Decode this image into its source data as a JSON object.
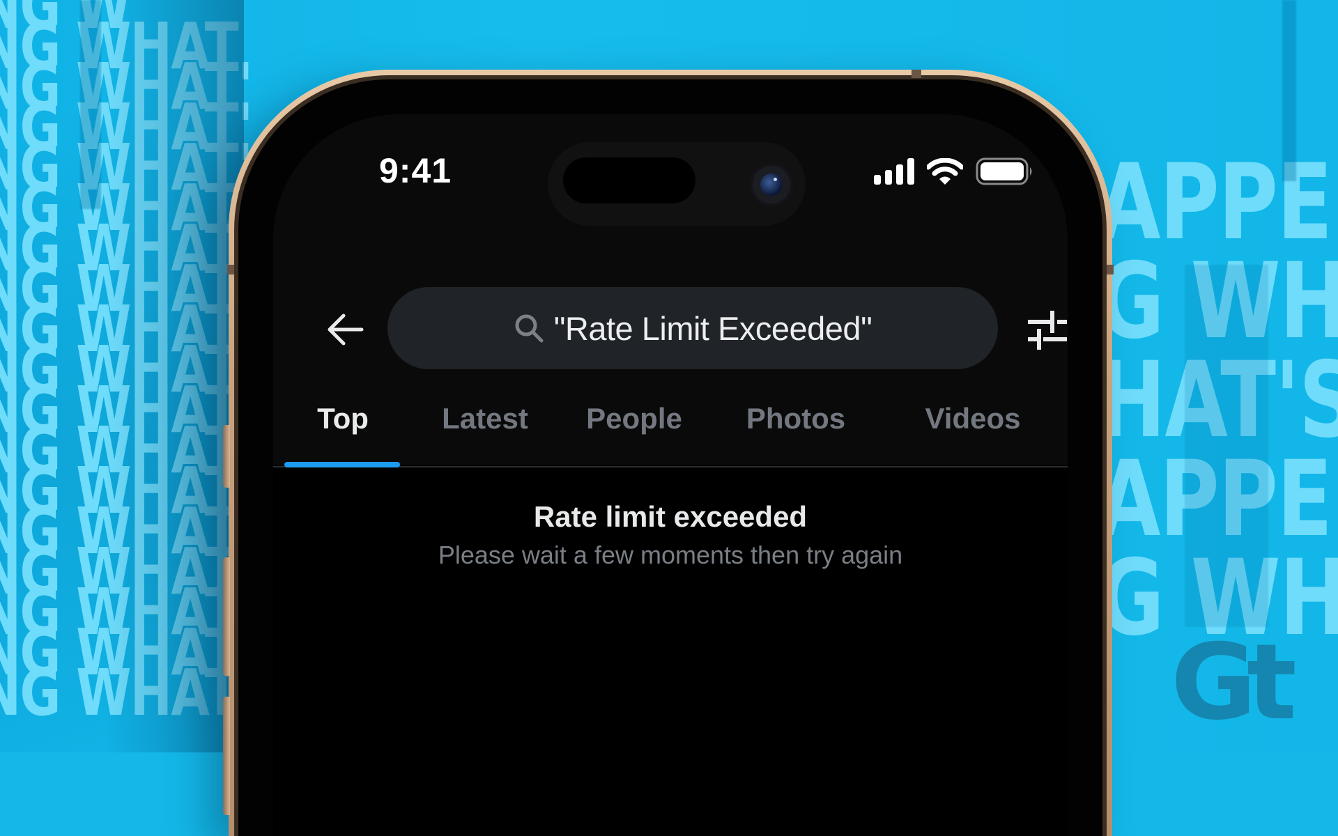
{
  "background": {
    "left_text_rows": [
      "NG W",
      "NG WHAT",
      "NG WHAT'",
      "NG WHAT'",
      "NG WHAT'",
      "NG WHAT'",
      "NG WHAT'",
      "NG WHAT'",
      "NG WHAT'",
      "NG WHAT'",
      "NG WHAT'",
      "NG WHAT'",
      "NG WHAT'",
      "NG WHAT'",
      "NG WHAT'",
      "NG WHAT'",
      "NG WHAT'",
      "NG WHAT'"
    ],
    "right_text_rows": [
      "APPENIN",
      "G WHAT'",
      "HAT'S HA",
      "APPENIN",
      "G WHAT'"
    ],
    "colors": {
      "base": "#13b8e8",
      "text": "#6fdcfb"
    }
  },
  "watermark": {
    "logo_text": "Gt"
  },
  "status_bar": {
    "time": "9:41",
    "icons": [
      "cellular-signal-icon",
      "wifi-icon",
      "battery-icon"
    ],
    "battery_level": 1.0
  },
  "search": {
    "query": "\"Rate Limit Exceeded\"",
    "back_icon": "arrow-left-icon",
    "search_icon": "magnifier-icon",
    "filter_icon": "sliders-icon"
  },
  "tabs": [
    {
      "label": "Top",
      "active": true
    },
    {
      "label": "Latest",
      "active": false
    },
    {
      "label": "People",
      "active": false
    },
    {
      "label": "Photos",
      "active": false
    },
    {
      "label": "Videos",
      "active": false
    }
  ],
  "empty_state": {
    "title": "Rate limit exceeded",
    "message": "Please wait a few moments then try again"
  },
  "colors": {
    "accent": "#1d9bf0",
    "screen_bg": "#000000",
    "search_bg": "#202327",
    "tab_inactive": "#737880",
    "text_primary": "#e7e9ea",
    "text_secondary": "#7a7f85",
    "phone_frame": "#c9a27f"
  }
}
